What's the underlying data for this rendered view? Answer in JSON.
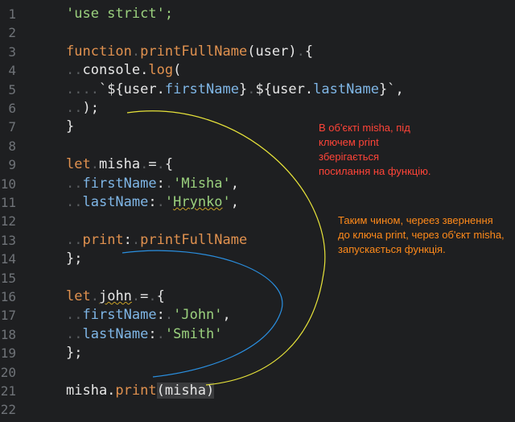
{
  "lines": [
    {
      "n": "1",
      "tokens": [
        {
          "t": "'use strict';",
          "c": "str"
        }
      ]
    },
    {
      "n": "2",
      "tokens": []
    },
    {
      "n": "3",
      "tokens": [
        {
          "t": "function",
          "c": "kw"
        },
        {
          "t": ".",
          "c": "dot"
        },
        {
          "t": "printFullName",
          "c": "fn"
        },
        {
          "t": "(user)",
          "c": "plain"
        },
        {
          "t": ".",
          "c": "dot"
        },
        {
          "t": "{",
          "c": "plain"
        }
      ]
    },
    {
      "n": "4",
      "tokens": [
        {
          "t": "..",
          "c": "dot"
        },
        {
          "t": "console.",
          "c": "plain"
        },
        {
          "t": "log",
          "c": "fn"
        },
        {
          "t": "(",
          "c": "plain"
        }
      ]
    },
    {
      "n": "5",
      "tokens": [
        {
          "t": "....",
          "c": "dot"
        },
        {
          "t": "`${user.",
          "c": "plain"
        },
        {
          "t": "firstName",
          "c": "prop"
        },
        {
          "t": "}",
          "c": "plain"
        },
        {
          "t": ".",
          "c": "dot"
        },
        {
          "t": "${user.",
          "c": "plain"
        },
        {
          "t": "lastName",
          "c": "prop"
        },
        {
          "t": "}`",
          "c": "plain"
        },
        {
          "t": ",",
          "c": "plain"
        }
      ]
    },
    {
      "n": "6",
      "tokens": [
        {
          "t": "..",
          "c": "dot"
        },
        {
          "t": ");",
          "c": "plain"
        }
      ]
    },
    {
      "n": "7",
      "tokens": [
        {
          "t": "}",
          "c": "plain"
        }
      ]
    },
    {
      "n": "8",
      "tokens": []
    },
    {
      "n": "9",
      "tokens": [
        {
          "t": "let",
          "c": "kw"
        },
        {
          "t": ".",
          "c": "dot"
        },
        {
          "t": "misha",
          "c": "plain"
        },
        {
          "t": ".",
          "c": "dot"
        },
        {
          "t": "=",
          "c": "plain"
        },
        {
          "t": ".",
          "c": "dot"
        },
        {
          "t": "{",
          "c": "plain"
        }
      ]
    },
    {
      "n": "10",
      "tokens": [
        {
          "t": "..",
          "c": "dot"
        },
        {
          "t": "firstName",
          "c": "prop"
        },
        {
          "t": ":",
          "c": "plain"
        },
        {
          "t": ".",
          "c": "dot"
        },
        {
          "t": "'Misha'",
          "c": "str"
        },
        {
          "t": ",",
          "c": "plain"
        }
      ]
    },
    {
      "n": "11",
      "tokens": [
        {
          "t": "..",
          "c": "dot"
        },
        {
          "t": "lastName",
          "c": "prop"
        },
        {
          "t": ":",
          "c": "plain"
        },
        {
          "t": ".",
          "c": "dot"
        },
        {
          "t": "'",
          "c": "str"
        },
        {
          "t": "Hrynko",
          "c": "str squig"
        },
        {
          "t": "'",
          "c": "str"
        },
        {
          "t": ",",
          "c": "plain"
        }
      ]
    },
    {
      "n": "12",
      "tokens": []
    },
    {
      "n": "13",
      "tokens": [
        {
          "t": "..",
          "c": "dot"
        },
        {
          "t": "print",
          "c": "fn"
        },
        {
          "t": ":",
          "c": "plain"
        },
        {
          "t": ".",
          "c": "dot"
        },
        {
          "t": "printFullName",
          "c": "fn"
        }
      ]
    },
    {
      "n": "14",
      "tokens": [
        {
          "t": "};",
          "c": "plain"
        }
      ]
    },
    {
      "n": "15",
      "tokens": []
    },
    {
      "n": "16",
      "tokens": [
        {
          "t": "let",
          "c": "kw"
        },
        {
          "t": ".",
          "c": "dot"
        },
        {
          "t": "john",
          "c": "plain squig"
        },
        {
          "t": ".",
          "c": "dot"
        },
        {
          "t": "=",
          "c": "plain"
        },
        {
          "t": ".",
          "c": "dot"
        },
        {
          "t": "{",
          "c": "plain"
        }
      ]
    },
    {
      "n": "17",
      "tokens": [
        {
          "t": "..",
          "c": "dot"
        },
        {
          "t": "firstName",
          "c": "prop"
        },
        {
          "t": ":",
          "c": "plain"
        },
        {
          "t": ".",
          "c": "dot"
        },
        {
          "t": "'John'",
          "c": "str"
        },
        {
          "t": ",",
          "c": "plain"
        }
      ]
    },
    {
      "n": "18",
      "tokens": [
        {
          "t": "..",
          "c": "dot"
        },
        {
          "t": "lastName",
          "c": "prop"
        },
        {
          "t": ":",
          "c": "plain"
        },
        {
          "t": ".",
          "c": "dot"
        },
        {
          "t": "'Smith'",
          "c": "str"
        }
      ]
    },
    {
      "n": "19",
      "tokens": [
        {
          "t": "};",
          "c": "plain"
        }
      ]
    },
    {
      "n": "20",
      "tokens": []
    },
    {
      "n": "21",
      "tokens": [
        {
          "t": "misha.",
          "c": "plain"
        },
        {
          "t": "print",
          "c": "fn"
        },
        {
          "t": "(misha)",
          "c": "plain hl"
        }
      ]
    },
    {
      "n": "22",
      "tokens": []
    }
  ],
  "notes": {
    "red": "В об'єкті misha, під ключем print зберігається посилання на функцію.",
    "orange": "Таким чином, череез звернення до ключа print, через об'єкт misha, запускається функція."
  },
  "colors": {
    "background": "#1e1f21",
    "note_red": "#ff4438",
    "note_orange": "#ff8a1a",
    "curve_yellow": "#e8e43a",
    "curve_blue": "#2a8fe0"
  }
}
